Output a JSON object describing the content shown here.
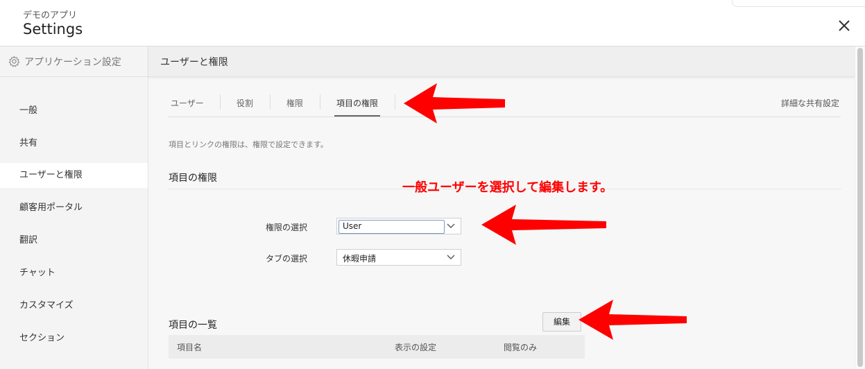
{
  "header": {
    "app_name": "デモのアプリ",
    "title": "Settings",
    "close_icon": "close-icon"
  },
  "sidebar": {
    "header_label": "アプリケーション設定",
    "header_icon": "gear-icon",
    "items": [
      {
        "label": "一般"
      },
      {
        "label": "共有"
      },
      {
        "label": "ユーザーと権限",
        "active": true
      },
      {
        "label": "顧客用ポータル"
      },
      {
        "label": "翻訳"
      },
      {
        "label": "チャット"
      },
      {
        "label": "カスタマイズ"
      },
      {
        "label": "セクション"
      }
    ]
  },
  "main": {
    "section_title": "ユーザーと権限",
    "tabs": [
      {
        "label": "ユーザー"
      },
      {
        "label": "役割"
      },
      {
        "label": "権限"
      },
      {
        "label": "項目の権限",
        "active": true
      }
    ],
    "share_link": "詳細な共有設定",
    "description": "項目とリンクの権限は、権限で設定できます。",
    "field_perm_heading": "項目の権限",
    "form": {
      "permission_label": "権限の選択",
      "permission_value": "User",
      "tab_label": "タブの選択",
      "tab_value": "休暇申請"
    },
    "field_list_heading": "項目の一覧",
    "edit_button": "編集",
    "table": {
      "columns": [
        "項目名",
        "表示の設定",
        "閲覧のみ"
      ]
    }
  },
  "annotations": {
    "instruction": "一般ユーザーを選択して編集します。",
    "arrow_color": "#ff0000"
  }
}
